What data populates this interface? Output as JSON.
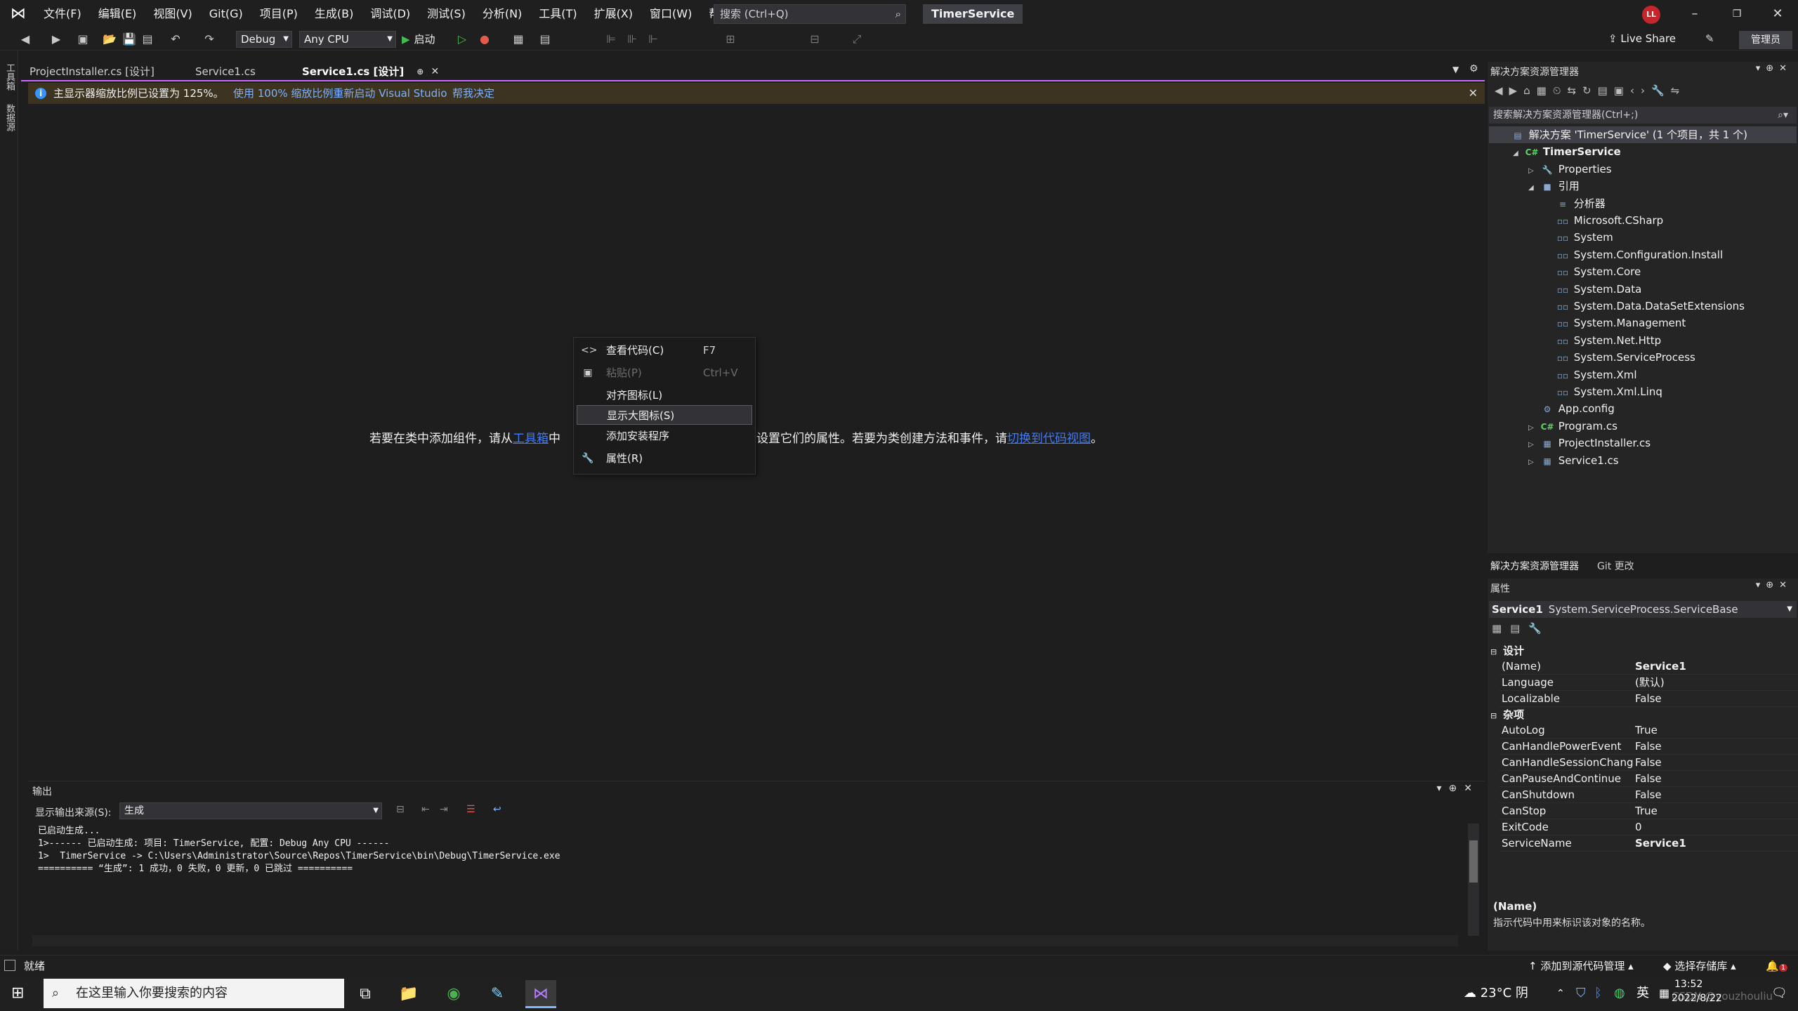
{
  "menu": [
    "文件(F)",
    "编辑(E)",
    "视图(V)",
    "Git(G)",
    "项目(P)",
    "生成(B)",
    "调试(D)",
    "测试(S)",
    "分析(N)",
    "工具(T)",
    "扩展(X)",
    "窗口(W)",
    "帮助(H)"
  ],
  "search": {
    "placeholder": "搜索 (Ctrl+Q)"
  },
  "solution_name": "TimerService",
  "user_initials": "LL",
  "toolbar": {
    "config": "Debug",
    "platform": "Any CPU",
    "start_label": "启动",
    "live_share": "Live Share",
    "admin": "管理员"
  },
  "left_rail": [
    "工具箱",
    "数据源"
  ],
  "doc_tabs": [
    "ProjectInstaller.cs [设计]",
    "Service1.cs",
    "Service1.cs [设计]"
  ],
  "infobar": {
    "text": "主显示器缩放比例已设置为 125%。",
    "link1": "使用 100% 缩放比例重新启动 Visual Studio",
    "link2": "帮我决定"
  },
  "designer": {
    "msg_part1": "若要在类中添加组件，请从",
    "link1": "工具箱",
    "msg_part2": "中",
    "msg_part3": "来设置它们的属性。若要为类创建方法和事件，请",
    "link2": "切换到代码视图",
    "msg_end": "。"
  },
  "context_menu": [
    {
      "icon": "<>",
      "label": "查看代码(C)",
      "shortcut": "F7",
      "disabled": false,
      "highlight": false
    },
    {
      "icon": "▣",
      "label": "粘贴(P)",
      "shortcut": "Ctrl+V",
      "disabled": true,
      "highlight": false
    },
    {
      "icon": "",
      "label": "对齐图标(L)",
      "shortcut": "",
      "disabled": false,
      "highlight": false
    },
    {
      "icon": "",
      "label": "显示大图标(S)",
      "shortcut": "",
      "disabled": false,
      "highlight": true
    },
    {
      "icon": "",
      "label": "添加安装程序",
      "shortcut": "",
      "disabled": false,
      "highlight": false
    },
    {
      "icon": "🔧",
      "label": "属性(R)",
      "shortcut": "",
      "disabled": false,
      "highlight": false
    }
  ],
  "output": {
    "title": "输出",
    "source_label": "显示输出来源(S):",
    "source_value": "生成",
    "lines": [
      "已启动生成...",
      "1>------ 已启动生成: 项目: TimerService, 配置: Debug Any CPU ------",
      "1>  TimerService -> C:\\Users\\Administrator\\Source\\Repos\\TimerService\\bin\\Debug\\TimerService.exe",
      "========== “生成”: 1 成功，0 失败，0 更新，0 已跳过 =========="
    ]
  },
  "solution_explorer": {
    "title": "解决方案资源管理器",
    "search_placeholder": "搜索解决方案资源管理器(Ctrl+;)",
    "tree": [
      {
        "label": "解决方案 'TimerService' (1 个项目，共 1 个)",
        "level": 0,
        "expander": "",
        "icon": "▤",
        "bold": false,
        "selected": true
      },
      {
        "label": "TimerService",
        "level": 1,
        "expander": "◢",
        "icon": "C#",
        "bold": true,
        "selected": false
      },
      {
        "label": "Properties",
        "level": 2,
        "expander": "▷",
        "icon": "🔧",
        "bold": false,
        "selected": false
      },
      {
        "label": "引用",
        "level": 2,
        "expander": "◢",
        "icon": "■",
        "bold": false,
        "selected": false
      },
      {
        "label": "分析器",
        "level": 3,
        "expander": "",
        "icon": "≡",
        "bold": false,
        "selected": false
      },
      {
        "label": "Microsoft.CSharp",
        "level": 3,
        "expander": "",
        "icon": "▫▫",
        "bold": false,
        "selected": false
      },
      {
        "label": "System",
        "level": 3,
        "expander": "",
        "icon": "▫▫",
        "bold": false,
        "selected": false
      },
      {
        "label": "System.Configuration.Install",
        "level": 3,
        "expander": "",
        "icon": "▫▫",
        "bold": false,
        "selected": false
      },
      {
        "label": "System.Core",
        "level": 3,
        "expander": "",
        "icon": "▫▫",
        "bold": false,
        "selected": false
      },
      {
        "label": "System.Data",
        "level": 3,
        "expander": "",
        "icon": "▫▫",
        "bold": false,
        "selected": false
      },
      {
        "label": "System.Data.DataSetExtensions",
        "level": 3,
        "expander": "",
        "icon": "▫▫",
        "bold": false,
        "selected": false
      },
      {
        "label": "System.Management",
        "level": 3,
        "expander": "",
        "icon": "▫▫",
        "bold": false,
        "selected": false
      },
      {
        "label": "System.Net.Http",
        "level": 3,
        "expander": "",
        "icon": "▫▫",
        "bold": false,
        "selected": false
      },
      {
        "label": "System.ServiceProcess",
        "level": 3,
        "expander": "",
        "icon": "▫▫",
        "bold": false,
        "selected": false
      },
      {
        "label": "System.Xml",
        "level": 3,
        "expander": "",
        "icon": "▫▫",
        "bold": false,
        "selected": false
      },
      {
        "label": "System.Xml.Linq",
        "level": 3,
        "expander": "",
        "icon": "▫▫",
        "bold": false,
        "selected": false
      },
      {
        "label": "App.config",
        "level": 2,
        "expander": "",
        "icon": "⚙",
        "bold": false,
        "selected": false
      },
      {
        "label": "Program.cs",
        "level": 2,
        "expander": "▷",
        "icon": "C#",
        "bold": false,
        "selected": false
      },
      {
        "label": "ProjectInstaller.cs",
        "level": 2,
        "expander": "▷",
        "icon": "▦",
        "bold": false,
        "selected": false
      },
      {
        "label": "Service1.cs",
        "level": 2,
        "expander": "▷",
        "icon": "▦",
        "bold": false,
        "selected": false
      }
    ],
    "tabs": [
      "解决方案资源管理器",
      "Git 更改"
    ]
  },
  "properties": {
    "title": "属性",
    "object_name": "Service1",
    "object_type": "System.ServiceProcess.ServiceBase",
    "categories": [
      {
        "name": "设计",
        "rows": [
          {
            "name": "(Name)",
            "value": "Service1",
            "bold": true
          },
          {
            "name": "Language",
            "value": "(默认)",
            "bold": false
          },
          {
            "name": "Localizable",
            "value": "False",
            "bold": false
          }
        ]
      },
      {
        "name": "杂项",
        "rows": [
          {
            "name": "AutoLog",
            "value": "True",
            "bold": false
          },
          {
            "name": "CanHandlePowerEvent",
            "value": "False",
            "bold": false
          },
          {
            "name": "CanHandleSessionChange",
            "value": "False",
            "bold": false
          },
          {
            "name": "CanPauseAndContinue",
            "value": "False",
            "bold": false
          },
          {
            "name": "CanShutdown",
            "value": "False",
            "bold": false
          },
          {
            "name": "CanStop",
            "value": "True",
            "bold": false
          },
          {
            "name": "ExitCode",
            "value": "0",
            "bold": false
          },
          {
            "name": "ServiceName",
            "value": "Service1",
            "bold": true
          }
        ]
      }
    ],
    "desc_title": "(Name)",
    "desc_text": "指示代码中用来标识该对象的名称。"
  },
  "statusbar": {
    "ready": "就绪",
    "add_source_control": "添加到源代码管理",
    "select_repo": "选择存储库",
    "notifications": "1"
  },
  "taskbar": {
    "search_placeholder": "在这里输入你要搜索的内容",
    "weather": "23°C 阴",
    "ime": "英",
    "time": "13:52",
    "date": "2022/8/22",
    "watermark": "CSDN @youzhouliu"
  }
}
